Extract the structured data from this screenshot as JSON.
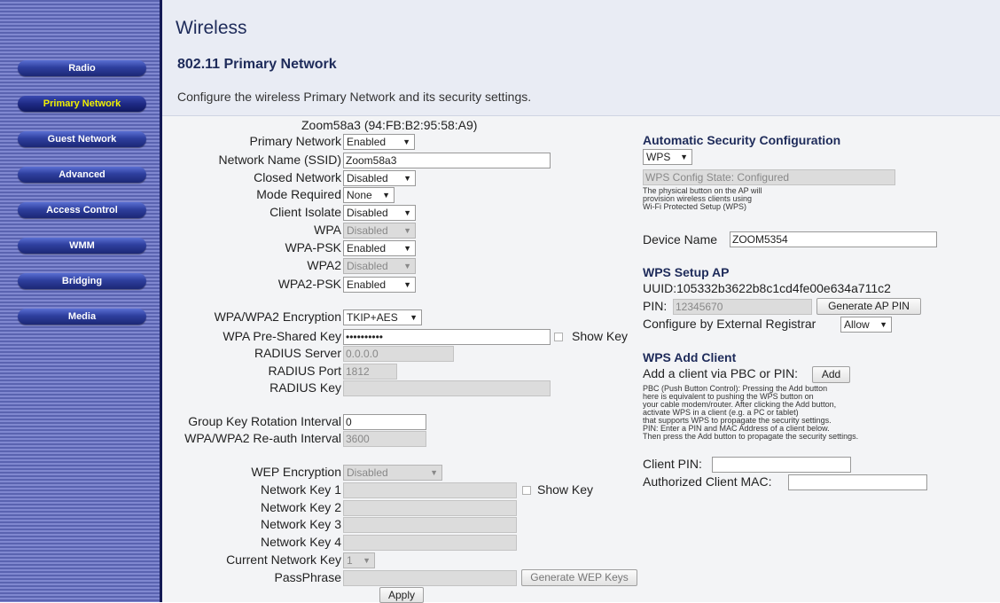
{
  "sidebar": {
    "items": [
      {
        "label": "Radio"
      },
      {
        "label": "Primary Network",
        "active": true
      },
      {
        "label": "Guest Network"
      },
      {
        "label": "Advanced"
      },
      {
        "label": "Access Control"
      },
      {
        "label": "WMM"
      },
      {
        "label": "Bridging"
      },
      {
        "label": "Media"
      }
    ]
  },
  "header": {
    "title": "Wireless",
    "subtitle": "802.11 Primary Network",
    "description": "Configure the wireless Primary Network and its security settings."
  },
  "network_info": "Zoom58a3 (94:FB:B2:95:58:A9)",
  "form": {
    "primary_network": {
      "label": "Primary Network",
      "value": "Enabled"
    },
    "ssid": {
      "label": "Network Name (SSID)",
      "value": "Zoom58a3"
    },
    "closed_network": {
      "label": "Closed Network",
      "value": "Disabled"
    },
    "mode_required": {
      "label": "Mode Required",
      "value": "None"
    },
    "client_isolate": {
      "label": "Client Isolate",
      "value": "Disabled"
    },
    "wpa": {
      "label": "WPA",
      "value": "Disabled"
    },
    "wpa_psk": {
      "label": "WPA-PSK",
      "value": "Enabled"
    },
    "wpa2": {
      "label": "WPA2",
      "value": "Disabled"
    },
    "wpa2_psk": {
      "label": "WPA2-PSK",
      "value": "Enabled"
    },
    "encryption": {
      "label": "WPA/WPA2 Encryption",
      "value": "TKIP+AES"
    },
    "psk": {
      "label": "WPA Pre-Shared Key",
      "value": "••••••••••",
      "show_key": "Show Key"
    },
    "radius_server": {
      "label": "RADIUS Server",
      "value": "0.0.0.0"
    },
    "radius_port": {
      "label": "RADIUS Port",
      "value": "1812"
    },
    "radius_key": {
      "label": "RADIUS Key",
      "value": ""
    },
    "group_key_rotation": {
      "label": "Group Key Rotation Interval",
      "value": "0"
    },
    "reauth_interval": {
      "label": "WPA/WPA2 Re-auth Interval",
      "value": "3600"
    },
    "wep_encryption": {
      "label": "WEP Encryption",
      "value": "Disabled"
    },
    "network_key_1": {
      "label": "Network Key 1",
      "value": "",
      "show_key": "Show Key"
    },
    "network_key_2": {
      "label": "Network Key 2",
      "value": ""
    },
    "network_key_3": {
      "label": "Network Key 3",
      "value": ""
    },
    "network_key_4": {
      "label": "Network Key 4",
      "value": ""
    },
    "current_network_key": {
      "label": "Current Network Key",
      "value": "1"
    },
    "passphrase": {
      "label": "PassPhrase",
      "value": ""
    },
    "generate_wep_keys": "Generate WEP Keys",
    "apply": "Apply"
  },
  "right": {
    "auto_security_title": "Automatic Security Configuration",
    "auto_security_value": "WPS",
    "wps_state": "WPS Config State: Configured",
    "wps_note": [
      "The physical button on the AP will",
      "provision wireless clients using",
      "Wi-Fi Protected Setup (WPS)"
    ],
    "device_name_label": "Device Name",
    "device_name_value": "ZOOM5354",
    "wps_setup_title": "WPS Setup AP",
    "uuid": "UUID:105332b3622b8c1cd4fe00e634a711c2",
    "pin_label": "PIN:",
    "pin_value": "12345670",
    "generate_pin": "Generate AP PIN",
    "external_registrar_label": "Configure by External Registrar",
    "external_registrar_value": "Allow",
    "add_client_title": "WPS Add Client",
    "add_client_label": "Add a client via PBC or PIN:",
    "add_button": "Add",
    "add_client_help": [
      "PBC (Push Button Control): Pressing the Add button",
      "here is equivalent to pushing the WPS button on",
      "your cable modem/router. After clicking the Add button,",
      "activate WPS in a client (e.g. a PC or tablet)",
      "that supports WPS to propagate the security settings.",
      "PIN: Enter a PIN and MAC Address of a client below.",
      "Then press the Add button to propagate the security settings."
    ],
    "client_pin_label": "Client PIN:",
    "client_pin_value": "",
    "authorized_mac_label": "Authorized Client MAC:",
    "authorized_mac_value": ""
  }
}
